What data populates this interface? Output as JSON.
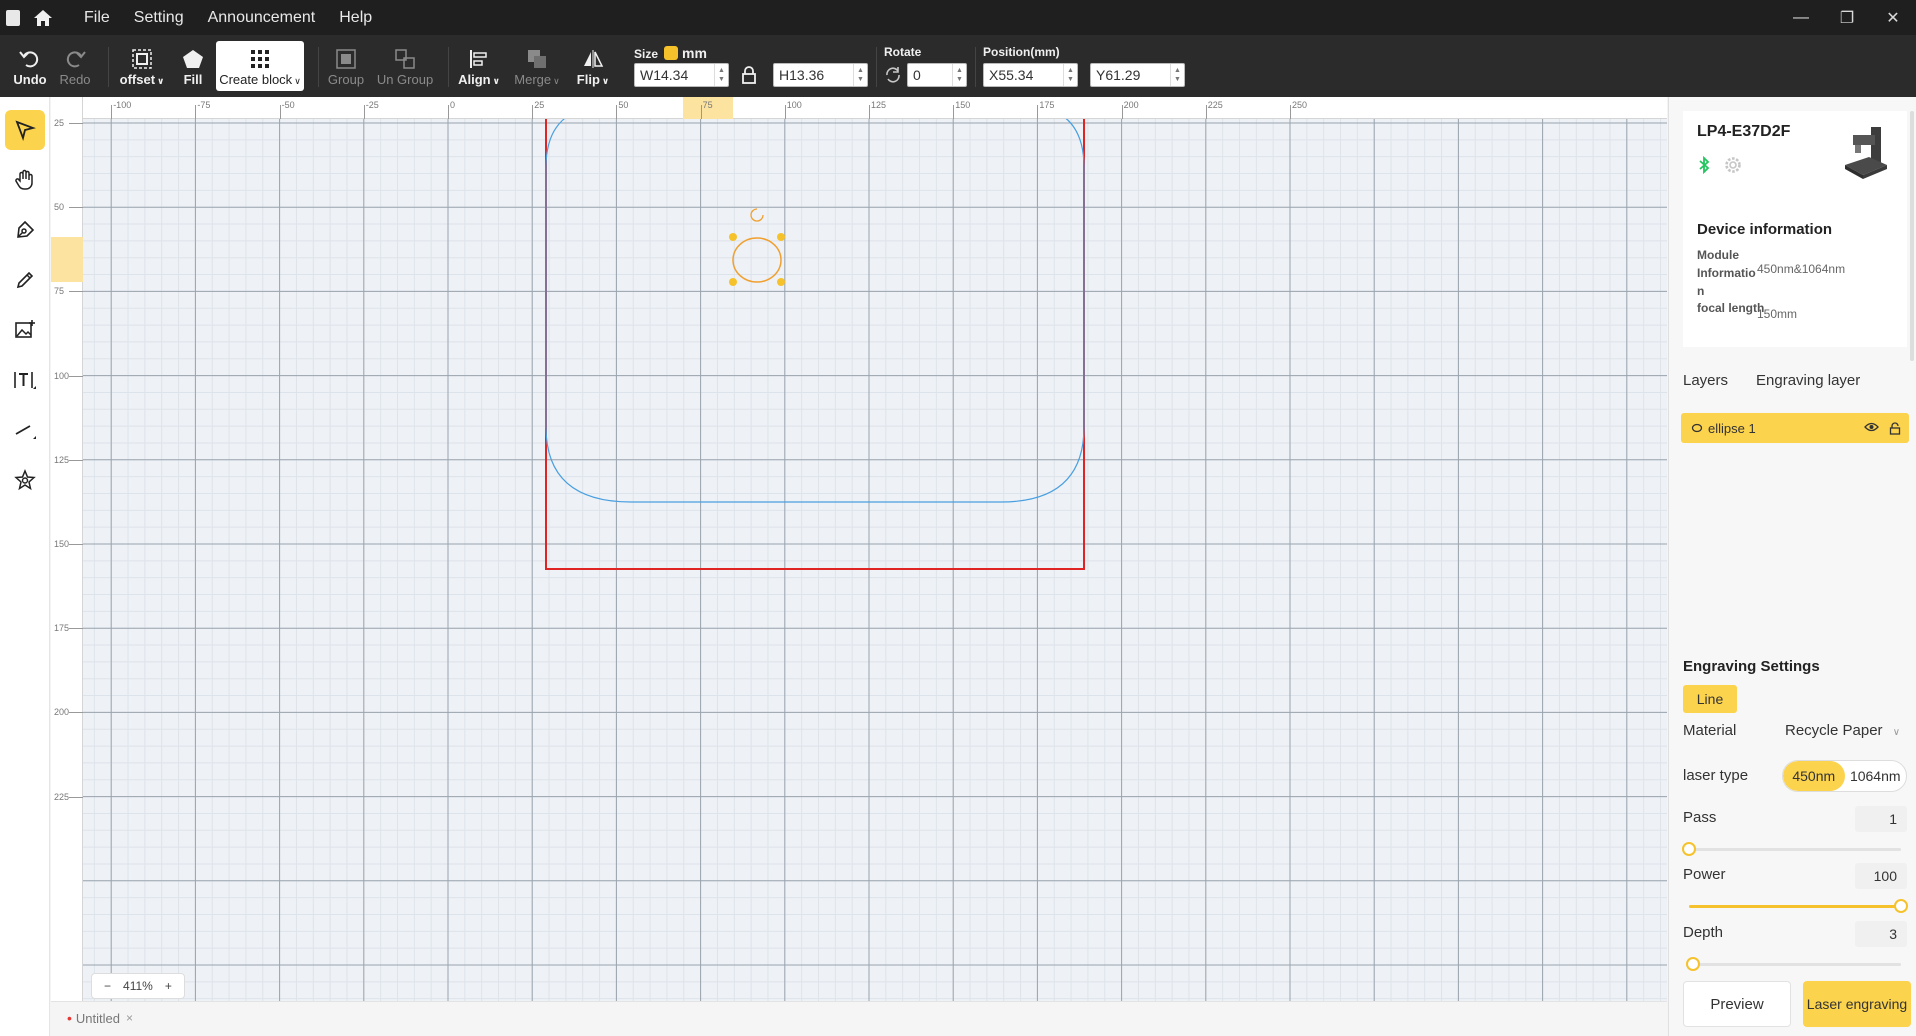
{
  "titlebar": {
    "menu": [
      "File",
      "Setting",
      "Announcement",
      "Help"
    ],
    "minimize": "—",
    "restore": "❐",
    "close": "✕"
  },
  "toolbar": {
    "undo": "Undo",
    "redo": "Redo",
    "offset": "offset",
    "fill": "Fill",
    "create_block": "Create block",
    "group": "Group",
    "ungroup": "Un Group",
    "align": "Align",
    "merge": "Merge",
    "flip": "Flip",
    "size_label": "Size",
    "unit": "mm",
    "width_prefix": "W",
    "width": "14.34",
    "height_prefix": "H",
    "height": "13.36",
    "rotate_label": "Rotate",
    "rotate": "0",
    "position_label": "Position(mm)",
    "x_prefix": "X",
    "x": "55.34",
    "y_prefix": "Y",
    "y": "61.29"
  },
  "canvas": {
    "ruler_top": [
      "-100",
      "-75",
      "-50",
      "-25",
      "0",
      "25",
      "50",
      "75",
      "100",
      "125",
      "150",
      "175",
      "200",
      "225",
      "250"
    ],
    "ruler_left": [
      "25",
      "50",
      "75",
      "100",
      "125",
      "150",
      "175",
      "200",
      "225"
    ],
    "zoom": "411%",
    "zoom_minus": "−",
    "zoom_plus": "+",
    "colors": {
      "grid_minor": "#dde3ea",
      "grid_major": "#9aa3ad",
      "work_area": "#e02424",
      "outline": "#4a9fe0",
      "selection": "#f0a030"
    }
  },
  "tabs": {
    "document": "Untitled",
    "dot": "•",
    "close": "×"
  },
  "device": {
    "name": "LP4-E37D2F",
    "info_title": "Device information",
    "module_key": "Module Informatio n",
    "module_value": "450nm&1064nm",
    "focal_key": "focal length",
    "focal_value": "150mm"
  },
  "layers": {
    "tab1": "Layers",
    "tab2": "Engraving layer",
    "items": [
      {
        "label": "ellipse 1"
      }
    ]
  },
  "engraving": {
    "title": "Engraving Settings",
    "line_tab": "Line",
    "material_label": "Material",
    "material_value": "Recycle Paper",
    "laser_type_label": "laser type",
    "laser_opt1": "450nm",
    "laser_opt2": "1064nm",
    "pass_label": "Pass",
    "pass_value": "1",
    "pass_level": 0,
    "power_label": "Power",
    "power_value": "100",
    "power_level": 1,
    "depth_label": "Depth",
    "depth_value": "3",
    "depth_level": 0.02,
    "preview": "Preview",
    "laser_engraving": "Laser engraving",
    "accent": "#fcd34d"
  }
}
